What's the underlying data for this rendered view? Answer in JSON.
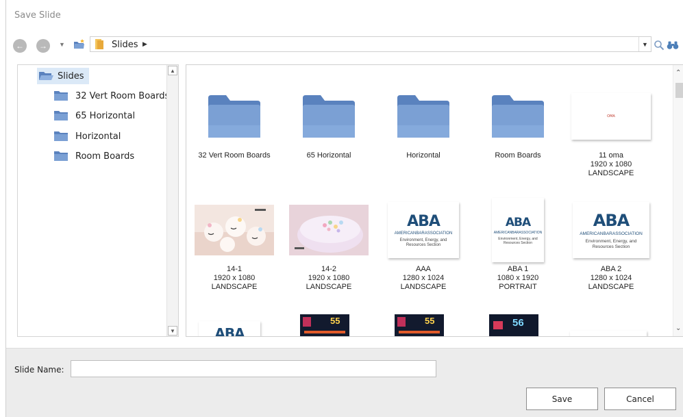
{
  "window": {
    "title": "Save Slide"
  },
  "navigation": {
    "back_icon": "back-arrow-icon",
    "forward_icon": "forward-arrow-icon",
    "breadcrumb": [
      "Slides"
    ]
  },
  "tree": {
    "root": "Slides",
    "items": [
      "32 Vert Room Boards",
      "65 Horizontal",
      "Horizontal",
      "Room Boards"
    ]
  },
  "files": [
    {
      "type": "folder",
      "name": "32 Vert Room Boards"
    },
    {
      "type": "folder",
      "name": "65 Horizontal"
    },
    {
      "type": "folder",
      "name": "Horizontal"
    },
    {
      "type": "folder",
      "name": "Room Boards"
    },
    {
      "type": "slide",
      "name": "11 oma",
      "size": "1920 x 1080",
      "orientation": "LANDSCAPE"
    },
    {
      "type": "slide",
      "name": "14-1",
      "size": "1920 x 1080",
      "orientation": "LANDSCAPE"
    },
    {
      "type": "slide",
      "name": "14-2",
      "size": "1920 x 1080",
      "orientation": "LANDSCAPE"
    },
    {
      "type": "slide",
      "name": "AAA",
      "size": "1280 x 1024",
      "orientation": "LANDSCAPE"
    },
    {
      "type": "slide",
      "name": "ABA 1",
      "size": "1080 x 1920",
      "orientation": "PORTRAIT"
    },
    {
      "type": "slide",
      "name": "ABA 2",
      "size": "1280 x 1024",
      "orientation": "LANDSCAPE"
    }
  ],
  "thumb_text": {
    "aba": "ABA",
    "aba_org": "AMERICANBARASSOCIATION",
    "aba_section": "Environment, Energy, and Resources Section",
    "oma": "OMA",
    "neon_55": "55",
    "neon_56": "56"
  },
  "footer": {
    "slide_name_label": "Slide Name:",
    "slide_name_value": "",
    "save_label": "Save",
    "cancel_label": "Cancel"
  },
  "colors": {
    "folder": "#7ba0d4",
    "folder_dark": "#5a82be",
    "aba_blue": "#1f4e79",
    "selection": "#dbe9f7"
  }
}
